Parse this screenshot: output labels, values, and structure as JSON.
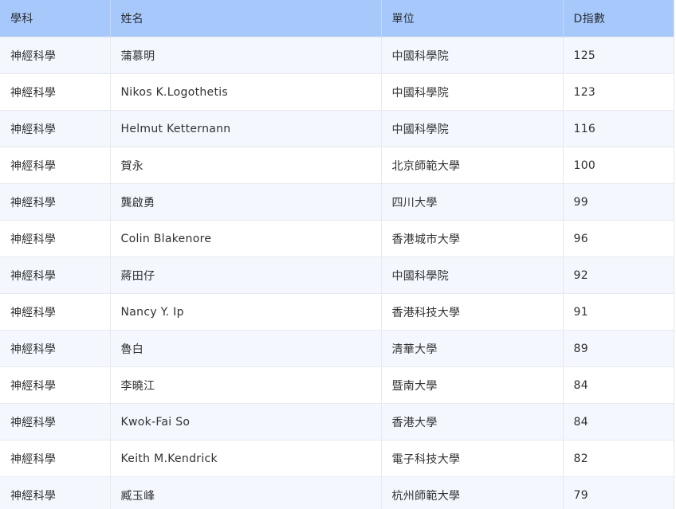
{
  "table": {
    "headers": [
      "學科",
      "姓名",
      "單位",
      "D指數"
    ],
    "rows": [
      {
        "subject": "神經科學",
        "name": "蒲慕明",
        "unit": "中國科學院",
        "d_index": "125"
      },
      {
        "subject": "神經科學",
        "name": "Nikos K.Logothetis",
        "unit": "中國科學院",
        "d_index": "123"
      },
      {
        "subject": "神經科學",
        "name": "Helmut Ketternann",
        "unit": "中國科學院",
        "d_index": "116"
      },
      {
        "subject": "神經科學",
        "name": "賀永",
        "unit": "北京師範大學",
        "d_index": "100"
      },
      {
        "subject": "神經科學",
        "name": "龔啟勇",
        "unit": "四川大學",
        "d_index": "99"
      },
      {
        "subject": "神經科學",
        "name": "Colin Blakenore",
        "unit": "香港城市大學",
        "d_index": "96"
      },
      {
        "subject": "神經科學",
        "name": "蔣田仔",
        "unit": "中國科學院",
        "d_index": "92"
      },
      {
        "subject": "神經科學",
        "name": "Nancy Y. Ip",
        "unit": "香港科技大學",
        "d_index": "91"
      },
      {
        "subject": "神經科學",
        "name": "魯白",
        "unit": "清華大學",
        "d_index": "89"
      },
      {
        "subject": "神經科學",
        "name": "李曉江",
        "unit": "暨南大學",
        "d_index": "84"
      },
      {
        "subject": "神經科學",
        "name": "Kwok-Fai So",
        "unit": "香港大學",
        "d_index": "84"
      },
      {
        "subject": "神經科學",
        "name": "Keith M.Kendrick",
        "unit": "電子科技大學",
        "d_index": "82"
      },
      {
        "subject": "神經科學",
        "name": "臧玉峰",
        "unit": "杭州師範大學",
        "d_index": "79"
      }
    ]
  },
  "colors": {
    "header_bg": "#a6c8fb",
    "row_odd_bg": "#f4f8fe",
    "row_even_bg": "#ffffff",
    "border": "#e6e9ee",
    "text": "#303133"
  }
}
